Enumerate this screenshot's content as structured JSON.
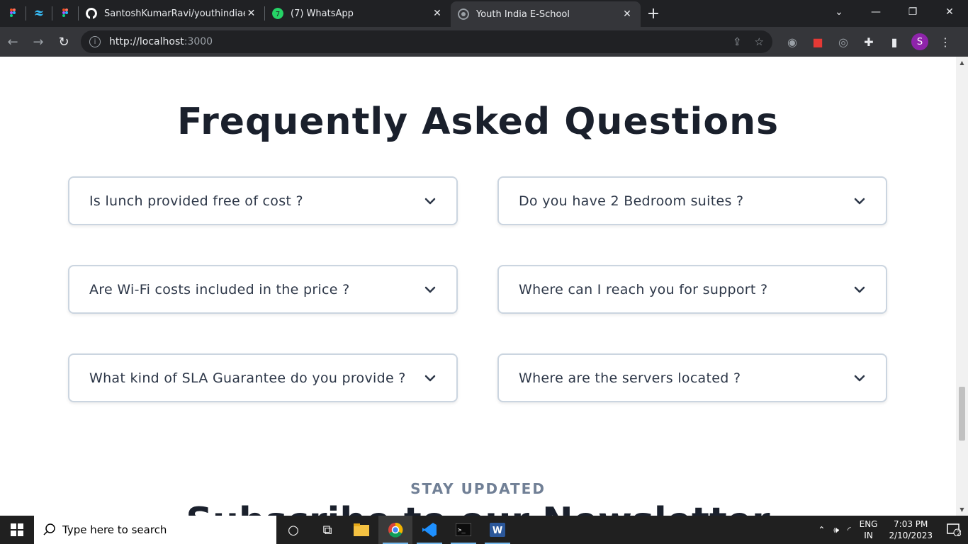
{
  "browser": {
    "tabs": [
      {
        "title": "SantoshKumarRavi/youthindiaes",
        "close": "✕"
      },
      {
        "title": "(7) WhatsApp",
        "close": "✕"
      },
      {
        "title": "Youth India E-School",
        "close": "✕"
      }
    ],
    "new_tab": "+",
    "url_host": "http://localhost",
    "url_port": ":3000",
    "profile_initial": "S",
    "window_controls": {
      "chevron": "⌄",
      "minimize": "—",
      "restore": "❐",
      "close": "✕"
    },
    "colors": {
      "profile": "#8e24aa",
      "whatsapp": "#25d366"
    }
  },
  "faq": {
    "title": "Frequently Asked Questions",
    "questions": [
      "Is lunch provided free of cost ?",
      "Do you have 2 Bedroom suites ?",
      "Are Wi-Fi costs included in the price ?",
      "Where can I reach you for support ?",
      "What kind of SLA Guarantee do you provide ?",
      "Where are the servers located ?"
    ]
  },
  "newsletter": {
    "eyebrow": "STAY UPDATED",
    "heading": "Subscribe to our Newsletter"
  },
  "taskbar": {
    "search_placeholder": "Type here to search",
    "lang_top": "ENG",
    "lang_bottom": "IN",
    "time": "7:03 PM",
    "date": "2/10/2023",
    "notification_count": "2"
  }
}
